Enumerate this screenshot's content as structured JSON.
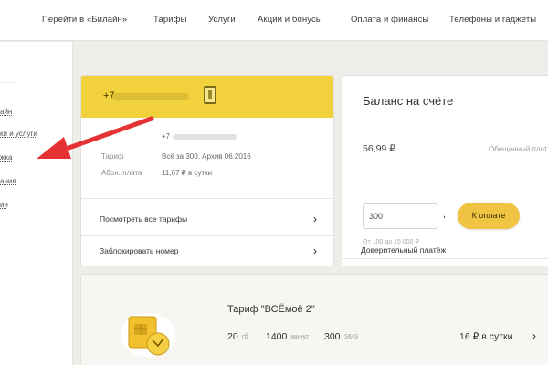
{
  "topnav": {
    "items": [
      "Перейти в «Билайн»",
      "Тарифы",
      "Услуги",
      "Акции и бонусы",
      "Оплата и финансы",
      "Телефоны и гаджеты"
    ]
  },
  "sidebar": {
    "items": [
      "айн",
      "ки и услуги",
      "жка",
      "ания",
      "ия"
    ]
  },
  "account": {
    "number": "+7",
    "rows": [
      {
        "label": "",
        "value": "+7"
      },
      {
        "label": "Тариф",
        "value": "Всё за 300. Архив 06.2016"
      },
      {
        "label": "Абон. плата",
        "value": "11,67 ₽ в сутки"
      }
    ],
    "links": [
      "Посмотреть все тарифы",
      "Заблокировать номер"
    ]
  },
  "balance": {
    "title": "Баланс на счёте",
    "amount": "56,99 ₽",
    "promised": "Обещанный плат",
    "input_value": "300",
    "comma": ",",
    "pay_button": "К оплате",
    "hint": "От 100 до 15 000 ₽",
    "trust_payment": "Доверительный платёж"
  },
  "tariff": {
    "name": "Тариф \"ВСЁмоё 2\"",
    "gb_value": "20",
    "gb_unit": "гб",
    "min_value": "1400",
    "min_unit": "минут",
    "sms_value": "300",
    "sms_unit": "SMS",
    "price": "16 ₽ в сутки",
    "chevron": "›"
  },
  "colors": {
    "accent_yellow": "#f2d23c",
    "button_yellow": "#f0c443",
    "arrow_red": "#e53232"
  },
  "icons": {
    "phone": "phone-icon",
    "sim": "sim-card-icon",
    "chevron": "chevron-right-icon",
    "arrow": "red-arrow-annotation"
  }
}
